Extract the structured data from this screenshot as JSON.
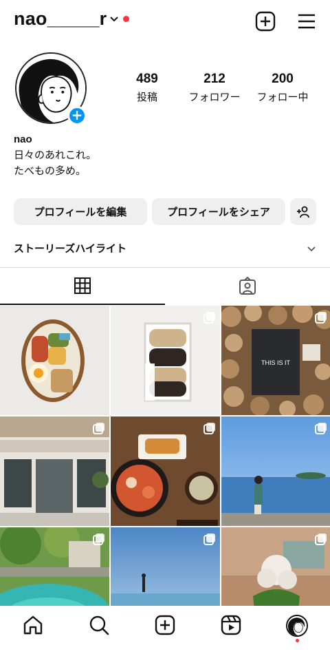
{
  "header": {
    "username": "nao_____r",
    "accent": "#ff3040"
  },
  "profile": {
    "stats": {
      "posts": {
        "value": "489",
        "label": "投稿"
      },
      "followers": {
        "value": "212",
        "label": "フォロワー"
      },
      "following": {
        "value": "200",
        "label": "フォロー中"
      }
    },
    "name": "nao",
    "bio_line1": "日々のあれこれ。",
    "bio_line2": "たべもの多め。"
  },
  "actions": {
    "edit_label": "プロフィールを編集",
    "share_label": "プロフィールをシェア"
  },
  "highlights": {
    "label": "ストーリーズハイライト"
  },
  "grid_text": {
    "tile3_caption": "THIS IS IT"
  },
  "icons": [
    "chevron-down-icon",
    "new-post-icon",
    "menu-icon",
    "add-story-icon",
    "add-person-icon",
    "chevron-down-icon",
    "grid-icon",
    "tagged-icon",
    "multi-post-icon",
    "home-icon",
    "search-icon",
    "create-icon",
    "reels-icon"
  ],
  "colors": {
    "brand_blue": "#0095f6",
    "button_bg": "#efefef",
    "notification": "#ff3040"
  }
}
